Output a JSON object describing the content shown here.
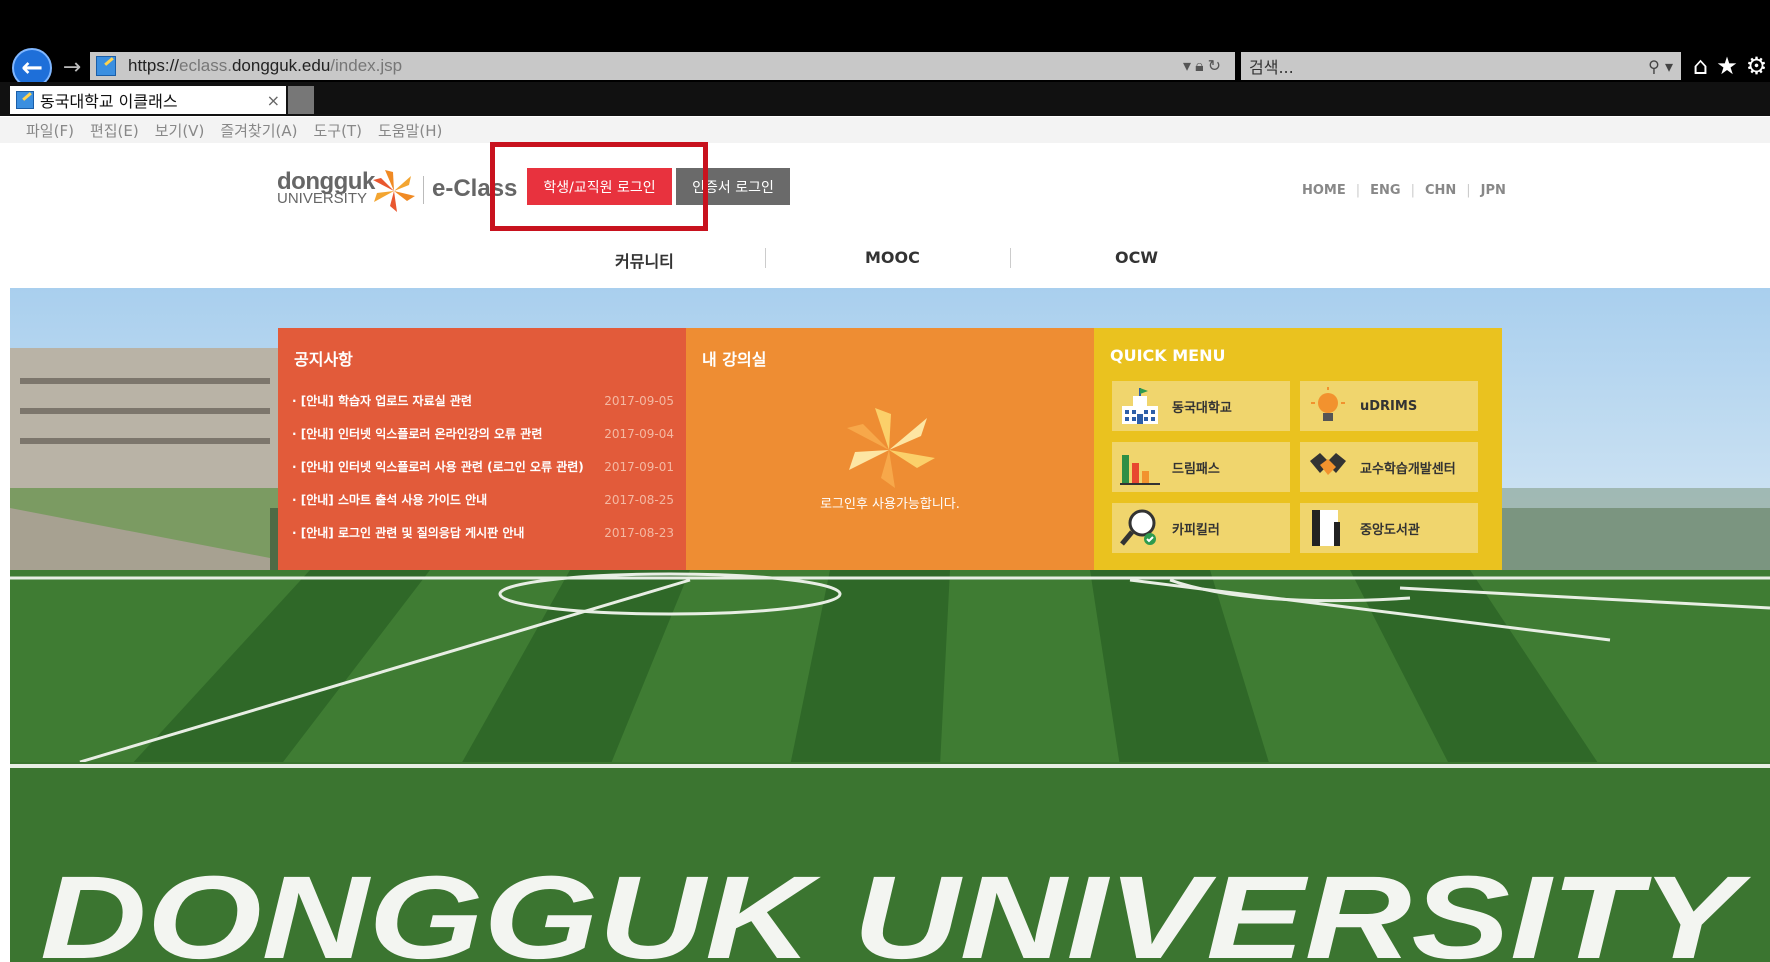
{
  "browser": {
    "url_prefix": "https://",
    "url_sub": "eclass.",
    "url_domain": "dongguk.edu",
    "url_path": "/index.jsp",
    "search_placeholder": "검색...",
    "tab_title": "동국대학교 이클래스",
    "tab_close": "×",
    "menu": [
      "파일(F)",
      "편집(E)",
      "보기(V)",
      "즐겨찾기(A)",
      "도구(T)",
      "도움말(H)"
    ]
  },
  "header": {
    "logo_word": "dongguk",
    "logo_sub": "UNIVERSITY",
    "eclass": "e-Class",
    "login_button": "학생/교직원 로그인",
    "cert_button": "인증서 로그인",
    "util_links": [
      "HOME",
      "ENG",
      "CHN",
      "JPN"
    ]
  },
  "nav": [
    "커뮤니티",
    "MOOC",
    "OCW"
  ],
  "notice": {
    "title": "공지사항",
    "items": [
      {
        "title": "· [안내] 학습자 업로드 자료실 관련",
        "date": "2017-09-05"
      },
      {
        "title": "· [안내] 인터넷 익스플로러 온라인강의 오류 관련",
        "date": "2017-09-04"
      },
      {
        "title": "· [안내] 인터넷 익스플로러 사용 관련 (로그인 오류 관련)",
        "date": "2017-09-01"
      },
      {
        "title": "· [안내] 스마트 출석 사용 가이드 안내",
        "date": "2017-08-25"
      },
      {
        "title": "· [안내] 로그인 관련 및 질의응답 게시판 안내",
        "date": "2017-08-23"
      }
    ]
  },
  "my_class": {
    "title": "내 강의실",
    "message": "로그인후 사용가능합니다."
  },
  "quick_menu": {
    "title": "QUICK MENU",
    "items": [
      {
        "label": "동국대학교",
        "icon": "school-building-icon"
      },
      {
        "label": "uDRIMS",
        "icon": "lightbulb-icon"
      },
      {
        "label": "드림패스",
        "icon": "bar-chart-icon"
      },
      {
        "label": "교수학습개발센터",
        "icon": "handshake-icon"
      },
      {
        "label": "카피킬러",
        "icon": "magnifier-check-icon"
      },
      {
        "label": "중앙도서관",
        "icon": "book-icon"
      }
    ]
  },
  "hero_banner_text": "DONGGUK UNIVERSITY",
  "colors": {
    "login_red": "#e8323e",
    "notice_panel": "#e25b3a",
    "class_panel": "#ee8d33",
    "quick_panel": "#eac21f",
    "highlight": "#c8121e"
  }
}
